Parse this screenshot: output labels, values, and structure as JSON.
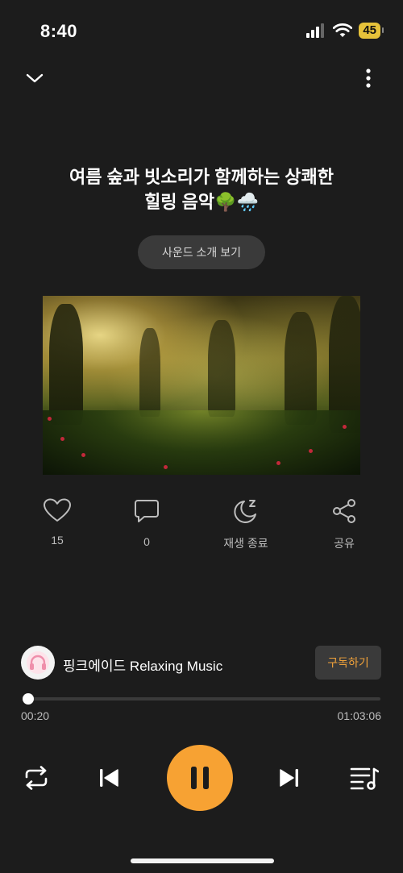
{
  "status_bar": {
    "time": "8:40",
    "battery": "45",
    "icons": [
      "cellular-signal-icon",
      "wifi-icon",
      "battery-icon"
    ]
  },
  "header": {
    "icons": [
      "chevron-down-icon",
      "more-vertical-icon"
    ]
  },
  "track": {
    "title_line1": "여름 숲과 빗소리가 함께하는 상쾌한",
    "title_line2": "힐링 음악🌳🌧️",
    "intro_button_label": "사운드 소개 보기"
  },
  "actions": [
    {
      "icon": "heart-icon",
      "label": "15"
    },
    {
      "icon": "comment-icon",
      "label": "0"
    },
    {
      "icon": "sleep-timer-icon",
      "label": "재생 종료"
    },
    {
      "icon": "share-icon",
      "label": "공유"
    }
  ],
  "channel": {
    "name": "핑크에이드 Relaxing Music",
    "subscribe_label": "구독하기"
  },
  "progress": {
    "current_time": "00:20",
    "total_time": "01:03:06",
    "fraction": 0.005
  },
  "controls": {
    "icons": [
      "repeat-icon",
      "previous-icon",
      "pause-icon",
      "next-icon",
      "playlist-icon"
    ]
  },
  "colors": {
    "background": "#1c1c1c",
    "accent": "#f7a233",
    "subscribe_text": "#f0a23a"
  }
}
